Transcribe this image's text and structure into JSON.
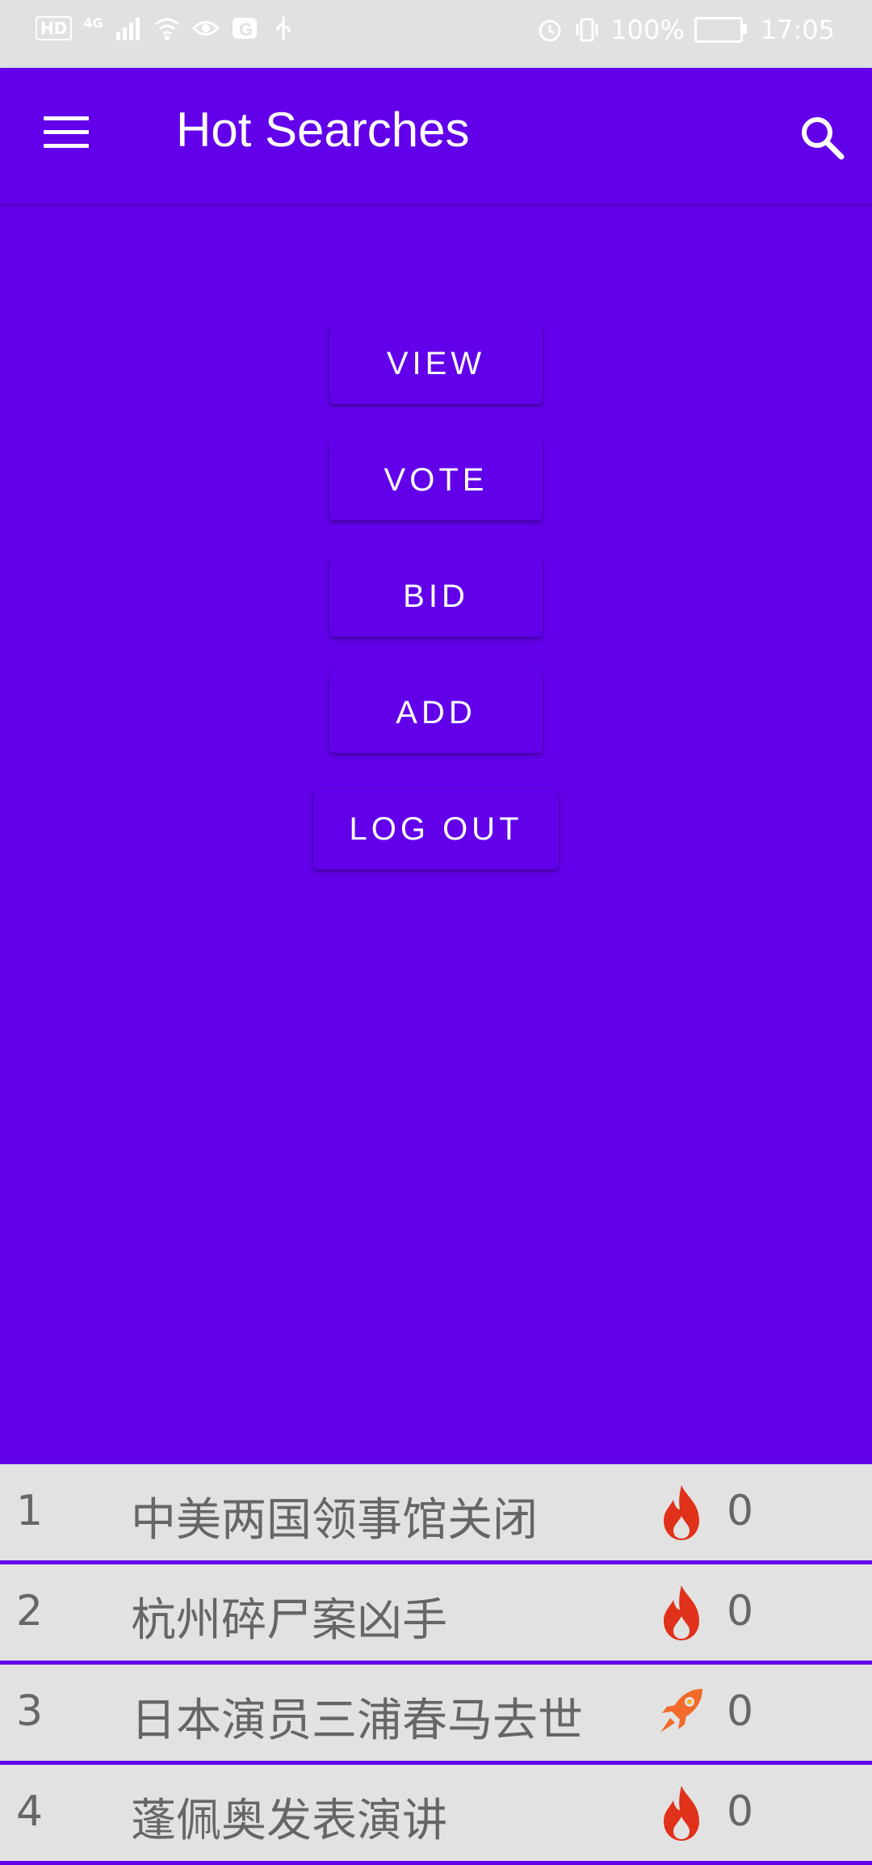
{
  "status_bar": {
    "left_badges": [
      "HD",
      "4G"
    ],
    "battery": "100%",
    "time": "17:05"
  },
  "app_bar": {
    "title": "Hot Searches",
    "menu_icon": "hamburger-menu-icon",
    "search_icon": "search-icon"
  },
  "actions": {
    "view": "VIEW",
    "vote": "VOTE",
    "bid": "BID",
    "add": "ADD",
    "logout": "LOG OUT"
  },
  "hot_list": [
    {
      "rank": "1",
      "topic": "中美两国领事馆关闭",
      "icon": "fire-icon",
      "count": "0"
    },
    {
      "rank": "2",
      "topic": "杭州碎尸案凶手",
      "icon": "fire-icon",
      "count": "0"
    },
    {
      "rank": "3",
      "topic": "日本演员三浦春马去世",
      "icon": "rocket-icon",
      "count": "0"
    },
    {
      "rank": "4",
      "topic": "蓬佩奥发表演讲",
      "icon": "fire-icon",
      "count": "0"
    }
  ],
  "colors": {
    "primary": "#6200EA",
    "row_bg": "#e2e2e2",
    "fire": "#e0311a",
    "rocket": "#f26b2a"
  }
}
